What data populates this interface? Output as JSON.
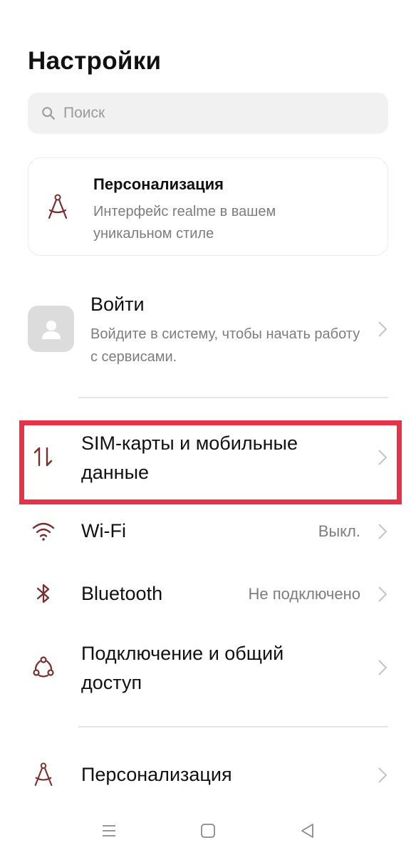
{
  "header": {
    "title": "Настройки"
  },
  "search": {
    "placeholder": "Поиск"
  },
  "promo": {
    "title": "Персонализация",
    "subtitle": "Интерфейс realme в вашем уникальном стиле"
  },
  "login": {
    "title": "Войти",
    "subtitle": "Войдите в систему, чтобы начать работу с сервисами."
  },
  "items": [
    {
      "label": "SIM-карты и мобильные данные",
      "value": "",
      "icon": "sim-data-arrows-icon"
    },
    {
      "label": "Wi-Fi",
      "value": "Выкл.",
      "icon": "wifi-icon"
    },
    {
      "label": "Bluetooth",
      "value": "Не подключено",
      "icon": "bluetooth-icon"
    },
    {
      "label": "Подключение и общий доступ",
      "value": "",
      "icon": "connection-sharing-icon"
    },
    {
      "label": "Персонализация",
      "value": "",
      "icon": "compass-icon"
    }
  ],
  "colors": {
    "accent_icon": "#7a2e2e",
    "highlight": "#e6334a"
  }
}
